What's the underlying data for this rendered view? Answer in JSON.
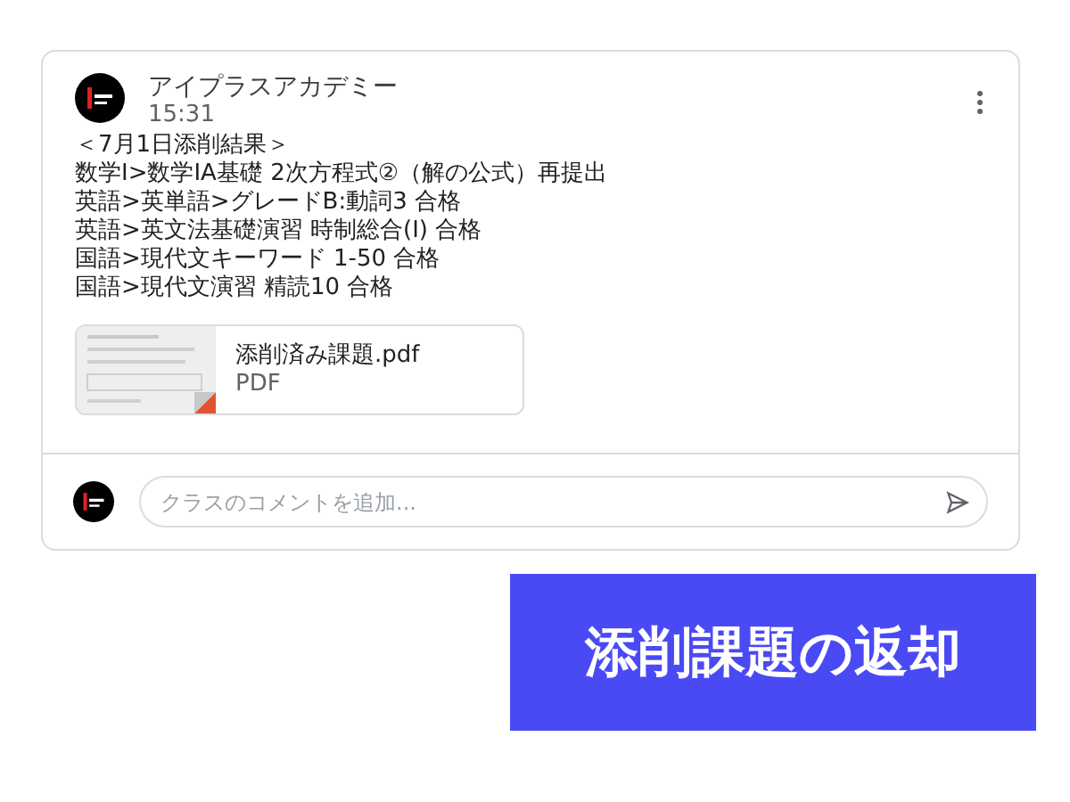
{
  "post": {
    "author": "アイプラスアカデミー",
    "time": "15:31",
    "lines": [
      "＜7月1日添削結果＞",
      "数学I>数学IA基礎 2次方程式②（解の公式）再提出",
      "英語>英単語>グレードB:動詞3 合格",
      "英語>英文法基礎演習 時制総合(I) 合格",
      "国語>現代文キーワード 1-50 合格",
      "国語>現代文演習 精読10 合格"
    ],
    "attachment": {
      "name": "添削済み課題.pdf",
      "type": "PDF"
    },
    "comment": {
      "placeholder": "クラスのコメントを追加..."
    }
  },
  "banner": "添削課題の返却"
}
